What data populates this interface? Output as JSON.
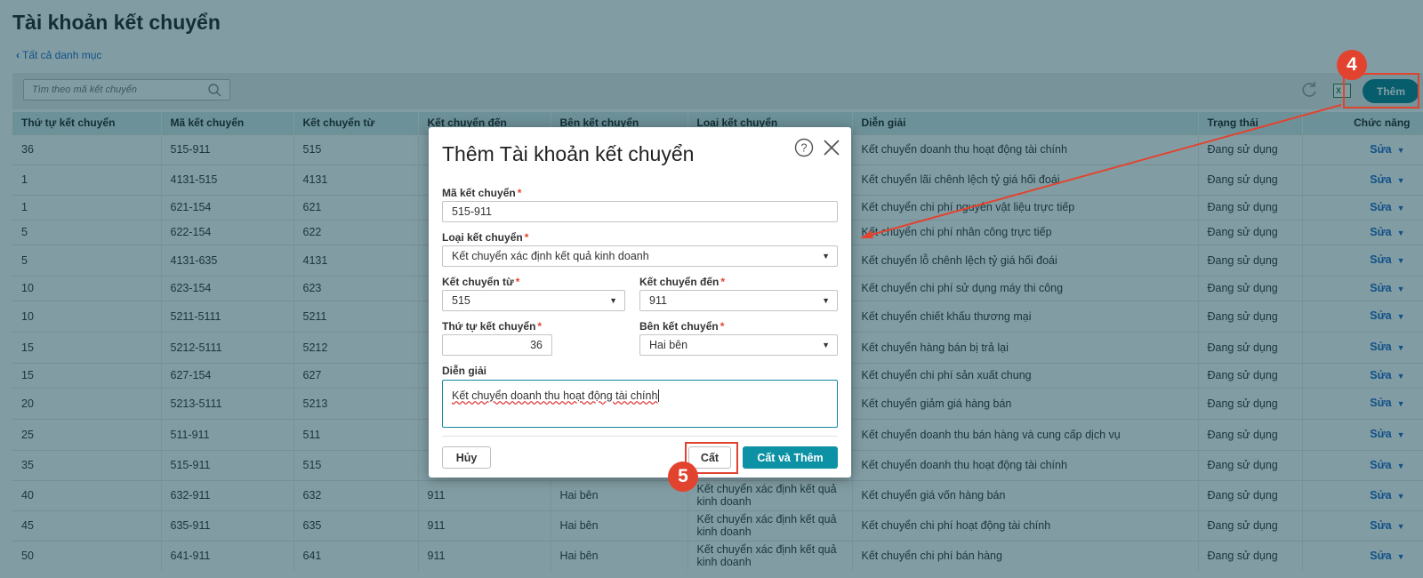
{
  "page": {
    "title": "Tài khoản kết chuyển",
    "back_link": "Tất cả danh mục"
  },
  "toolbar": {
    "search_placeholder": "Tìm theo mã kết chuyển",
    "add_label": "Thêm",
    "excel_label": "X"
  },
  "table": {
    "columns": [
      "Thứ tự kết chuyển",
      "Mã kết chuyển",
      "Kết chuyển từ",
      "Kết chuyển đến",
      "Bên kết chuyển",
      "Loại kết chuyển",
      "Diễn giải",
      "Trạng thái",
      "Chức năng"
    ],
    "rows": [
      {
        "order": "36",
        "code": "515-911",
        "from": "515",
        "to": "",
        "side": "",
        "type": "",
        "desc": "Kết chuyển doanh thu hoạt động tài chính",
        "status": "Đang sử dụng",
        "action": "Sửa"
      },
      {
        "order": "1",
        "code": "4131-515",
        "from": "4131",
        "to": "",
        "side": "",
        "type": "",
        "desc": "Kết chuyển lãi chênh lệch tỷ giá hối đoái",
        "status": "Đang sử dụng",
        "action": "Sửa"
      },
      {
        "order": "1",
        "code": "621-154",
        "from": "621",
        "to": "",
        "side": "",
        "type": "",
        "desc": "Kết chuyển chi phí nguyên vật liệu trực tiếp",
        "status": "Đang sử dụng",
        "action": "Sửa"
      },
      {
        "order": "5",
        "code": "622-154",
        "from": "622",
        "to": "",
        "side": "",
        "type": "",
        "desc": "Kết chuyển chi phí nhân công trực tiếp",
        "status": "Đang sử dụng",
        "action": "Sửa"
      },
      {
        "order": "5",
        "code": "4131-635",
        "from": "4131",
        "to": "",
        "side": "",
        "type": "",
        "desc": "Kết chuyển lỗ chênh lệch tỷ giá hối đoái",
        "status": "Đang sử dụng",
        "action": "Sửa"
      },
      {
        "order": "10",
        "code": "623-154",
        "from": "623",
        "to": "",
        "side": "",
        "type": "",
        "desc": "Kết chuyển chi phí sử dụng máy thi công",
        "status": "Đang sử dụng",
        "action": "Sửa"
      },
      {
        "order": "10",
        "code": "5211-5111",
        "from": "5211",
        "to": "",
        "side": "",
        "type": "",
        "desc": "Kết chuyển chiết khấu thương mại",
        "status": "Đang sử dụng",
        "action": "Sửa"
      },
      {
        "order": "15",
        "code": "5212-5111",
        "from": "5212",
        "to": "",
        "side": "",
        "type": "",
        "desc": "Kết chuyển hàng bán bị trả lại",
        "status": "Đang sử dụng",
        "action": "Sửa"
      },
      {
        "order": "15",
        "code": "627-154",
        "from": "627",
        "to": "",
        "side": "",
        "type": "",
        "desc": "Kết chuyển chi phí sản xuất chung",
        "status": "Đang sử dụng",
        "action": "Sửa"
      },
      {
        "order": "20",
        "code": "5213-5111",
        "from": "5213",
        "to": "",
        "side": "",
        "type": "",
        "desc": "Kết chuyển giảm giá hàng bán",
        "status": "Đang sử dụng",
        "action": "Sửa"
      },
      {
        "order": "25",
        "code": "511-911",
        "from": "511",
        "to": "",
        "side": "",
        "type": "",
        "desc": "Kết chuyển doanh thu bán hàng và cung cấp dịch vụ",
        "status": "Đang sử dụng",
        "action": "Sửa"
      },
      {
        "order": "35",
        "code": "515-911",
        "from": "515",
        "to": "",
        "side": "",
        "type": "kinh doanh",
        "desc": "Kết chuyển doanh thu hoạt động tài chính",
        "status": "Đang sử dụng",
        "action": "Sửa"
      },
      {
        "order": "40",
        "code": "632-911",
        "from": "632",
        "to": "911",
        "side": "Hai bên",
        "type": "Kết chuyển xác định kết quả kinh doanh",
        "desc": "Kết chuyển giá vốn hàng bán",
        "status": "Đang sử dụng",
        "action": "Sửa"
      },
      {
        "order": "45",
        "code": "635-911",
        "from": "635",
        "to": "911",
        "side": "Hai bên",
        "type": "Kết chuyển xác định kết quả kinh doanh",
        "desc": "Kết chuyển chi phí hoạt động tài chính",
        "status": "Đang sử dụng",
        "action": "Sửa"
      },
      {
        "order": "50",
        "code": "641-911",
        "from": "641",
        "to": "911",
        "side": "Hai bên",
        "type": "Kết chuyển xác định kết quả kinh doanh",
        "desc": "Kết chuyển chi phí bán hàng",
        "status": "Đang sử dụng",
        "action": "Sửa"
      }
    ]
  },
  "modal": {
    "title": "Thêm Tài khoản kết chuyển",
    "fields": {
      "code_label": "Mã kết chuyển",
      "code_value": "515-911",
      "type_label": "Loại kết chuyển",
      "type_value": "Kết chuyển xác định kết quả kinh doanh",
      "from_label": "Kết chuyển từ",
      "from_value": "515",
      "to_label": "Kết chuyển đến",
      "to_value": "911",
      "order_label": "Thứ tự kết chuyển",
      "order_value": "36",
      "side_label": "Bên kết chuyển",
      "side_value": "Hai bên",
      "desc_label": "Diễn giải",
      "desc_value": "Kết chuyển doanh thu hoạt động tài chính"
    },
    "required_mark": "*",
    "buttons": {
      "cancel": "Hủy",
      "save": "Cất",
      "save_add": "Cất và Thêm"
    }
  },
  "annotations": {
    "step_add": "4",
    "step_save": "5"
  },
  "colors": {
    "primary": "#0c7e93",
    "annotation": "#e2432f",
    "link": "#1f62c8"
  }
}
